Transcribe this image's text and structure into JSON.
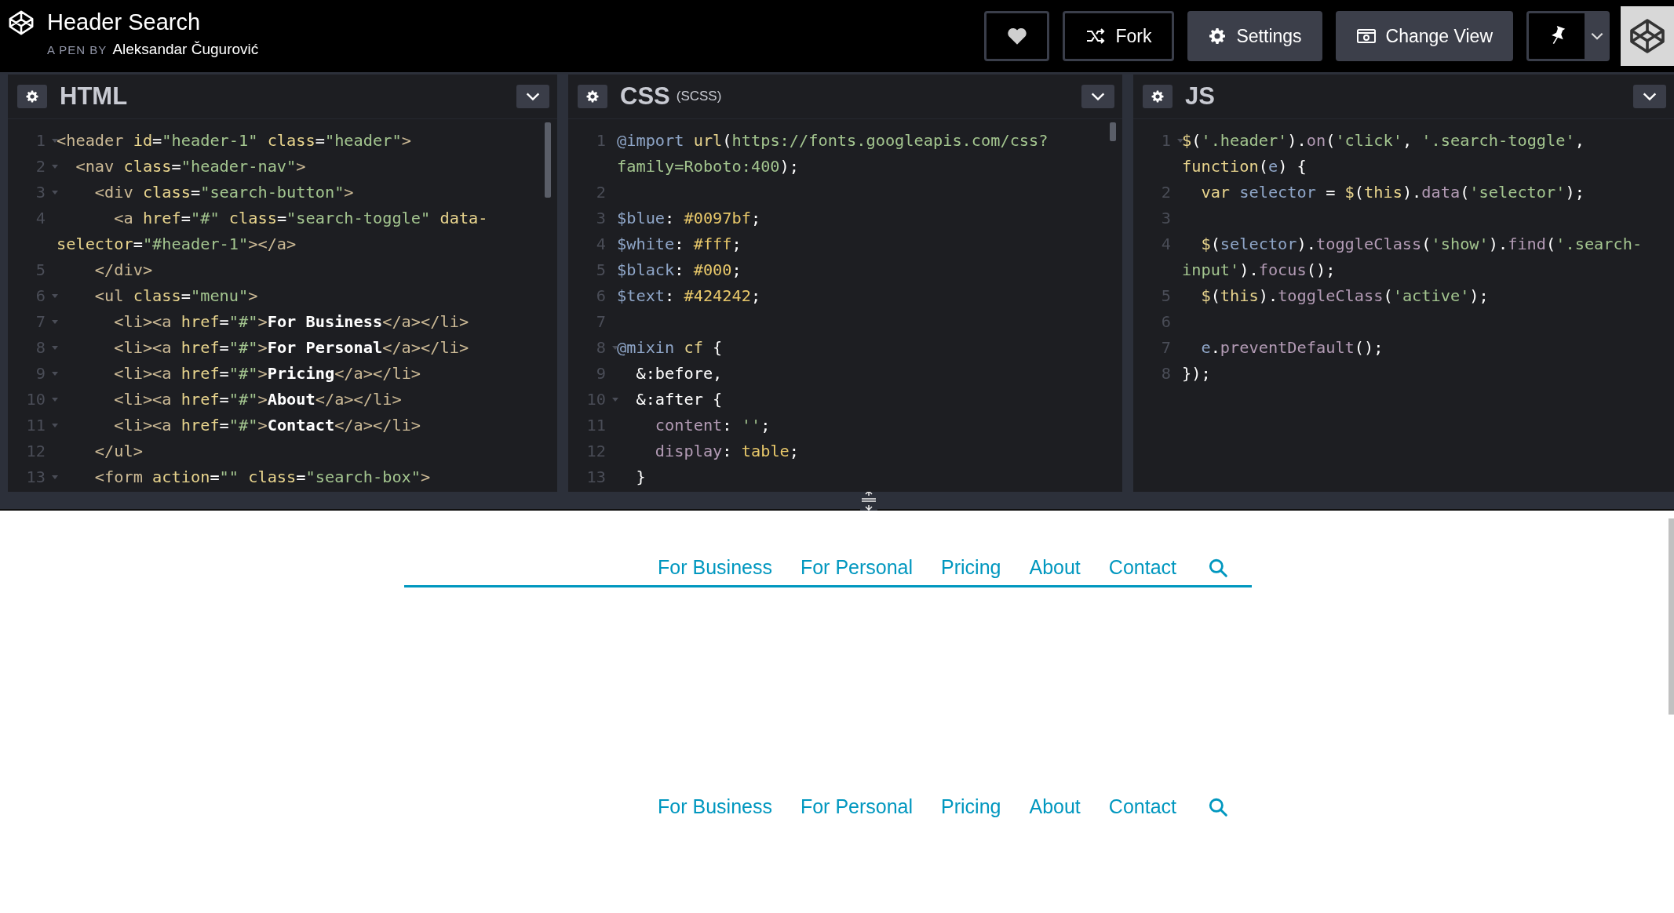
{
  "header": {
    "title": "Header Search",
    "byline_prefix": "A PEN BY",
    "author": "Aleksandar Čugurović",
    "buttons": [
      {
        "kind": "heart"
      },
      {
        "kind": "fork",
        "label": "Fork"
      },
      {
        "kind": "settings",
        "label": "Settings"
      },
      {
        "kind": "change_view",
        "label": "Change View"
      },
      {
        "kind": "pin"
      }
    ]
  },
  "editors": [
    {
      "title": "HTML",
      "lines": [
        {
          "number": "1",
          "fold": true,
          "tokens": [
            {
              "kind": "tag",
              "text": "<header "
            },
            {
              "kind": "attr",
              "text": "id"
            },
            {
              "kind": "plain",
              "text": "="
            },
            {
              "kind": "string",
              "text": "\"header-1\" "
            },
            {
              "kind": "attr",
              "text": "class"
            },
            {
              "kind": "plain",
              "text": "="
            },
            {
              "kind": "string",
              "text": "\"header\""
            },
            {
              "kind": "tag",
              "text": ">"
            }
          ]
        },
        {
          "number": "2",
          "fold": true,
          "tokens": [
            {
              "kind": "tag",
              "text": "  <nav "
            },
            {
              "kind": "attr",
              "text": "class"
            },
            {
              "kind": "plain",
              "text": "="
            },
            {
              "kind": "string",
              "text": "\"header-nav\""
            },
            {
              "kind": "tag",
              "text": ">"
            }
          ]
        },
        {
          "number": "3",
          "fold": true,
          "tokens": [
            {
              "kind": "tag",
              "text": "    <div "
            },
            {
              "kind": "attr",
              "text": "class"
            },
            {
              "kind": "plain",
              "text": "="
            },
            {
              "kind": "string",
              "text": "\"search-button\""
            },
            {
              "kind": "tag",
              "text": ">"
            }
          ]
        },
        {
          "number": "4",
          "fold": false,
          "tokens": [
            {
              "kind": "tag",
              "text": "      <a "
            },
            {
              "kind": "attr",
              "text": "href"
            },
            {
              "kind": "plain",
              "text": "="
            },
            {
              "kind": "string",
              "text": "\"#\" "
            },
            {
              "kind": "attr",
              "text": "class"
            },
            {
              "kind": "plain",
              "text": "="
            },
            {
              "kind": "string",
              "text": "\"search-toggle\" "
            },
            {
              "kind": "attr",
              "text": "data-"
            }
          ]
        },
        {
          "fold": false,
          "tokens": [
            {
              "kind": "attr",
              "text": "selector"
            },
            {
              "kind": "plain",
              "text": "="
            },
            {
              "kind": "string",
              "text": "\"#header-1\""
            },
            {
              "kind": "tag",
              "text": "></a>"
            }
          ]
        },
        {
          "number": "5",
          "fold": false,
          "tokens": [
            {
              "kind": "tag",
              "text": "    </div>"
            }
          ]
        },
        {
          "number": "6",
          "fold": true,
          "tokens": [
            {
              "kind": "tag",
              "text": "    <ul "
            },
            {
              "kind": "attr",
              "text": "class"
            },
            {
              "kind": "plain",
              "text": "="
            },
            {
              "kind": "string",
              "text": "\"menu\""
            },
            {
              "kind": "tag",
              "text": ">"
            }
          ]
        },
        {
          "number": "7",
          "fold": true,
          "tokens": [
            {
              "kind": "tag",
              "text": "      <li><a "
            },
            {
              "kind": "attr",
              "text": "href"
            },
            {
              "kind": "plain",
              "text": "="
            },
            {
              "kind": "string",
              "text": "\"#\""
            },
            {
              "kind": "tag",
              "text": ">"
            },
            {
              "kind": "content",
              "text": "For Business"
            },
            {
              "kind": "tag",
              "text": "</a></li>"
            }
          ]
        },
        {
          "number": "8",
          "fold": true,
          "tokens": [
            {
              "kind": "tag",
              "text": "      <li><a "
            },
            {
              "kind": "attr",
              "text": "href"
            },
            {
              "kind": "plain",
              "text": "="
            },
            {
              "kind": "string",
              "text": "\"#\""
            },
            {
              "kind": "tag",
              "text": ">"
            },
            {
              "kind": "content",
              "text": "For Personal"
            },
            {
              "kind": "tag",
              "text": "</a></li>"
            }
          ]
        },
        {
          "number": "9",
          "fold": true,
          "tokens": [
            {
              "kind": "tag",
              "text": "      <li><a "
            },
            {
              "kind": "attr",
              "text": "href"
            },
            {
              "kind": "plain",
              "text": "="
            },
            {
              "kind": "string",
              "text": "\"#\""
            },
            {
              "kind": "tag",
              "text": ">"
            },
            {
              "kind": "content",
              "text": "Pricing"
            },
            {
              "kind": "tag",
              "text": "</a></li>"
            }
          ]
        },
        {
          "number": "10",
          "fold": true,
          "tokens": [
            {
              "kind": "tag",
              "text": "      <li><a "
            },
            {
              "kind": "attr",
              "text": "href"
            },
            {
              "kind": "plain",
              "text": "="
            },
            {
              "kind": "string",
              "text": "\"#\""
            },
            {
              "kind": "tag",
              "text": ">"
            },
            {
              "kind": "content",
              "text": "About"
            },
            {
              "kind": "tag",
              "text": "</a></li>"
            }
          ]
        },
        {
          "number": "11",
          "fold": true,
          "tokens": [
            {
              "kind": "tag",
              "text": "      <li><a "
            },
            {
              "kind": "attr",
              "text": "href"
            },
            {
              "kind": "plain",
              "text": "="
            },
            {
              "kind": "string",
              "text": "\"#\""
            },
            {
              "kind": "tag",
              "text": ">"
            },
            {
              "kind": "content",
              "text": "Contact"
            },
            {
              "kind": "tag",
              "text": "</a></li>"
            }
          ]
        },
        {
          "number": "12",
          "fold": false,
          "tokens": [
            {
              "kind": "tag",
              "text": "    </ul>"
            }
          ]
        },
        {
          "number": "13",
          "fold": true,
          "tokens": [
            {
              "kind": "tag",
              "text": "    <form "
            },
            {
              "kind": "attr",
              "text": "action"
            },
            {
              "kind": "plain",
              "text": "="
            },
            {
              "kind": "string",
              "text": "\"\" "
            },
            {
              "kind": "attr",
              "text": "class"
            },
            {
              "kind": "plain",
              "text": "="
            },
            {
              "kind": "string",
              "text": "\"search-box\""
            },
            {
              "kind": "tag",
              "text": ">"
            }
          ]
        }
      ]
    },
    {
      "title": "CSS",
      "subtitle": "(SCSS)",
      "lines": [
        {
          "number": "1",
          "fold": false,
          "tokens": [
            {
              "kind": "atrule",
              "text": "@import "
            },
            {
              "kind": "keyword",
              "text": "url"
            },
            {
              "kind": "plain",
              "text": "("
            },
            {
              "kind": "string",
              "text": "https://fonts.googleapis.com/css?"
            }
          ]
        },
        {
          "fold": false,
          "tokens": [
            {
              "kind": "string",
              "text": "family=Roboto:400"
            },
            {
              "kind": "plain",
              "text": ");"
            }
          ]
        },
        {
          "number": "2",
          "fold": false
        },
        {
          "number": "3",
          "fold": false,
          "tokens": [
            {
              "kind": "variable",
              "text": "$blue"
            },
            {
              "kind": "plain",
              "text": ": "
            },
            {
              "kind": "value",
              "text": "#0097bf"
            },
            {
              "kind": "plain",
              "text": ";"
            }
          ]
        },
        {
          "number": "4",
          "fold": false,
          "tokens": [
            {
              "kind": "variable",
              "text": "$white"
            },
            {
              "kind": "plain",
              "text": ": "
            },
            {
              "kind": "value",
              "text": "#fff"
            },
            {
              "kind": "plain",
              "text": ";"
            }
          ]
        },
        {
          "number": "5",
          "fold": false,
          "tokens": [
            {
              "kind": "variable",
              "text": "$black"
            },
            {
              "kind": "plain",
              "text": ": "
            },
            {
              "kind": "value",
              "text": "#000"
            },
            {
              "kind": "plain",
              "text": ";"
            }
          ]
        },
        {
          "number": "6",
          "fold": false,
          "tokens": [
            {
              "kind": "variable",
              "text": "$text"
            },
            {
              "kind": "plain",
              "text": ": "
            },
            {
              "kind": "value",
              "text": "#424242"
            },
            {
              "kind": "plain",
              "text": ";"
            }
          ]
        },
        {
          "number": "7",
          "fold": false
        },
        {
          "number": "8",
          "fold": true,
          "tokens": [
            {
              "kind": "atrule",
              "text": "@mixin "
            },
            {
              "kind": "keyword",
              "text": "cf"
            },
            {
              "kind": "plain",
              "text": " {"
            }
          ]
        },
        {
          "number": "9",
          "fold": false,
          "tokens": [
            {
              "kind": "plain",
              "text": "  &:before,"
            }
          ]
        },
        {
          "number": "10",
          "fold": true,
          "tokens": [
            {
              "kind": "plain",
              "text": "  &:after {"
            }
          ]
        },
        {
          "number": "11",
          "fold": false,
          "tokens": [
            {
              "kind": "property",
              "text": "    content"
            },
            {
              "kind": "plain",
              "text": ": "
            },
            {
              "kind": "string",
              "text": "''"
            },
            {
              "kind": "plain",
              "text": ";"
            }
          ]
        },
        {
          "number": "12",
          "fold": false,
          "tokens": [
            {
              "kind": "property",
              "text": "    display"
            },
            {
              "kind": "plain",
              "text": ": "
            },
            {
              "kind": "value",
              "text": "table"
            },
            {
              "kind": "plain",
              "text": ";"
            }
          ]
        },
        {
          "number": "13",
          "fold": false,
          "tokens": [
            {
              "kind": "plain",
              "text": "  }"
            }
          ]
        }
      ]
    },
    {
      "title": "JS",
      "lines": [
        {
          "number": "1",
          "fold": true,
          "tokens": [
            {
              "kind": "keyword",
              "text": "$"
            },
            {
              "kind": "plain",
              "text": "("
            },
            {
              "kind": "string",
              "text": "'.header'"
            },
            {
              "kind": "plain",
              "text": ")."
            },
            {
              "kind": "method",
              "text": "on"
            },
            {
              "kind": "plain",
              "text": "("
            },
            {
              "kind": "string",
              "text": "'click'"
            },
            {
              "kind": "plain",
              "text": ", "
            },
            {
              "kind": "string",
              "text": "'.search-toggle'"
            },
            {
              "kind": "plain",
              "text": ","
            }
          ]
        },
        {
          "fold": false,
          "tokens": [
            {
              "kind": "keyword",
              "text": "function"
            },
            {
              "kind": "plain",
              "text": "("
            },
            {
              "kind": "variable",
              "text": "e"
            },
            {
              "kind": "plain",
              "text": ") {"
            }
          ]
        },
        {
          "number": "2",
          "fold": false,
          "tokens": [
            {
              "kind": "keyword",
              "text": "  var "
            },
            {
              "kind": "variable",
              "text": "selector"
            },
            {
              "kind": "plain",
              "text": " = "
            },
            {
              "kind": "keyword",
              "text": "$"
            },
            {
              "kind": "plain",
              "text": "("
            },
            {
              "kind": "keyword",
              "text": "this"
            },
            {
              "kind": "plain",
              "text": ")."
            },
            {
              "kind": "method",
              "text": "data"
            },
            {
              "kind": "plain",
              "text": "("
            },
            {
              "kind": "string",
              "text": "'selector'"
            },
            {
              "kind": "plain",
              "text": ");"
            }
          ]
        },
        {
          "number": "3",
          "fold": false
        },
        {
          "number": "4",
          "fold": false,
          "tokens": [
            {
              "kind": "keyword",
              "text": "  $"
            },
            {
              "kind": "plain",
              "text": "("
            },
            {
              "kind": "variable",
              "text": "selector"
            },
            {
              "kind": "plain",
              "text": ")."
            },
            {
              "kind": "method",
              "text": "toggleClass"
            },
            {
              "kind": "plain",
              "text": "("
            },
            {
              "kind": "string",
              "text": "'show'"
            },
            {
              "kind": "plain",
              "text": ")."
            },
            {
              "kind": "method",
              "text": "find"
            },
            {
              "kind": "plain",
              "text": "("
            },
            {
              "kind": "string",
              "text": "'.search-"
            }
          ]
        },
        {
          "fold": false,
          "tokens": [
            {
              "kind": "string",
              "text": "input'"
            },
            {
              "kind": "plain",
              "text": ")."
            },
            {
              "kind": "method",
              "text": "focus"
            },
            {
              "kind": "plain",
              "text": "();"
            }
          ]
        },
        {
          "number": "5",
          "fold": false,
          "tokens": [
            {
              "kind": "keyword",
              "text": "  $"
            },
            {
              "kind": "plain",
              "text": "("
            },
            {
              "kind": "keyword",
              "text": "this"
            },
            {
              "kind": "plain",
              "text": ")."
            },
            {
              "kind": "method",
              "text": "toggleClass"
            },
            {
              "kind": "plain",
              "text": "("
            },
            {
              "kind": "string",
              "text": "'active'"
            },
            {
              "kind": "plain",
              "text": ");"
            }
          ]
        },
        {
          "number": "6",
          "fold": false
        },
        {
          "number": "7",
          "fold": false,
          "tokens": [
            {
              "kind": "variable",
              "text": "  e"
            },
            {
              "kind": "plain",
              "text": "."
            },
            {
              "kind": "method",
              "text": "preventDefault"
            },
            {
              "kind": "plain",
              "text": "();"
            }
          ]
        },
        {
          "number": "8",
          "fold": false,
          "tokens": [
            {
              "kind": "plain",
              "text": "});"
            }
          ]
        }
      ]
    }
  ],
  "preview": {
    "navs": [
      {
        "underlined": true,
        "items": [
          "For Business",
          "For Personal",
          "Pricing",
          "About",
          "Contact"
        ]
      },
      {
        "underlined": false,
        "items": [
          "For Business",
          "For Personal",
          "Pricing",
          "About",
          "Contact"
        ]
      }
    ]
  }
}
